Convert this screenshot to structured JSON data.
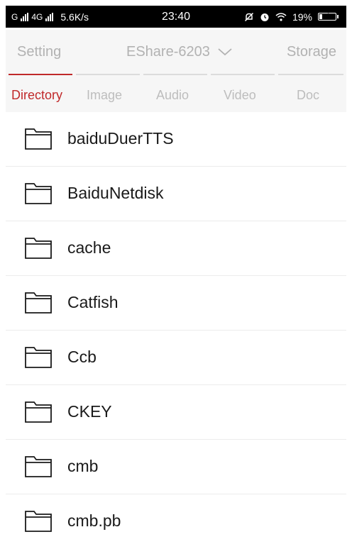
{
  "status_bar": {
    "network": "G",
    "network2": "4G",
    "speed": "5.6K/s",
    "time": "23:40",
    "battery": "19%",
    "battery_level": 0.19
  },
  "topnav": {
    "setting": "Setting",
    "device": "EShare-6203",
    "storage": "Storage"
  },
  "tabs": [
    {
      "label": "Directory",
      "active": true
    },
    {
      "label": "Image",
      "active": false
    },
    {
      "label": "Audio",
      "active": false
    },
    {
      "label": "Video",
      "active": false
    },
    {
      "label": "Doc",
      "active": false
    }
  ],
  "files": [
    {
      "name": "baiduDuerTTS",
      "icon": "folder-icon"
    },
    {
      "name": "BaiduNetdisk",
      "icon": "folder-icon"
    },
    {
      "name": "cache",
      "icon": "folder-icon"
    },
    {
      "name": "Catfish",
      "icon": "folder-icon"
    },
    {
      "name": "Ccb",
      "icon": "folder-icon"
    },
    {
      "name": "CKEY",
      "icon": "folder-icon"
    },
    {
      "name": "cmb",
      "icon": "folder-icon"
    },
    {
      "name": "cmb.pb",
      "icon": "folder-icon"
    }
  ],
  "colors": {
    "accent": "#c0292a",
    "inactive_text": "#b2b2b2",
    "nav_bg": "#f6f6f6"
  }
}
